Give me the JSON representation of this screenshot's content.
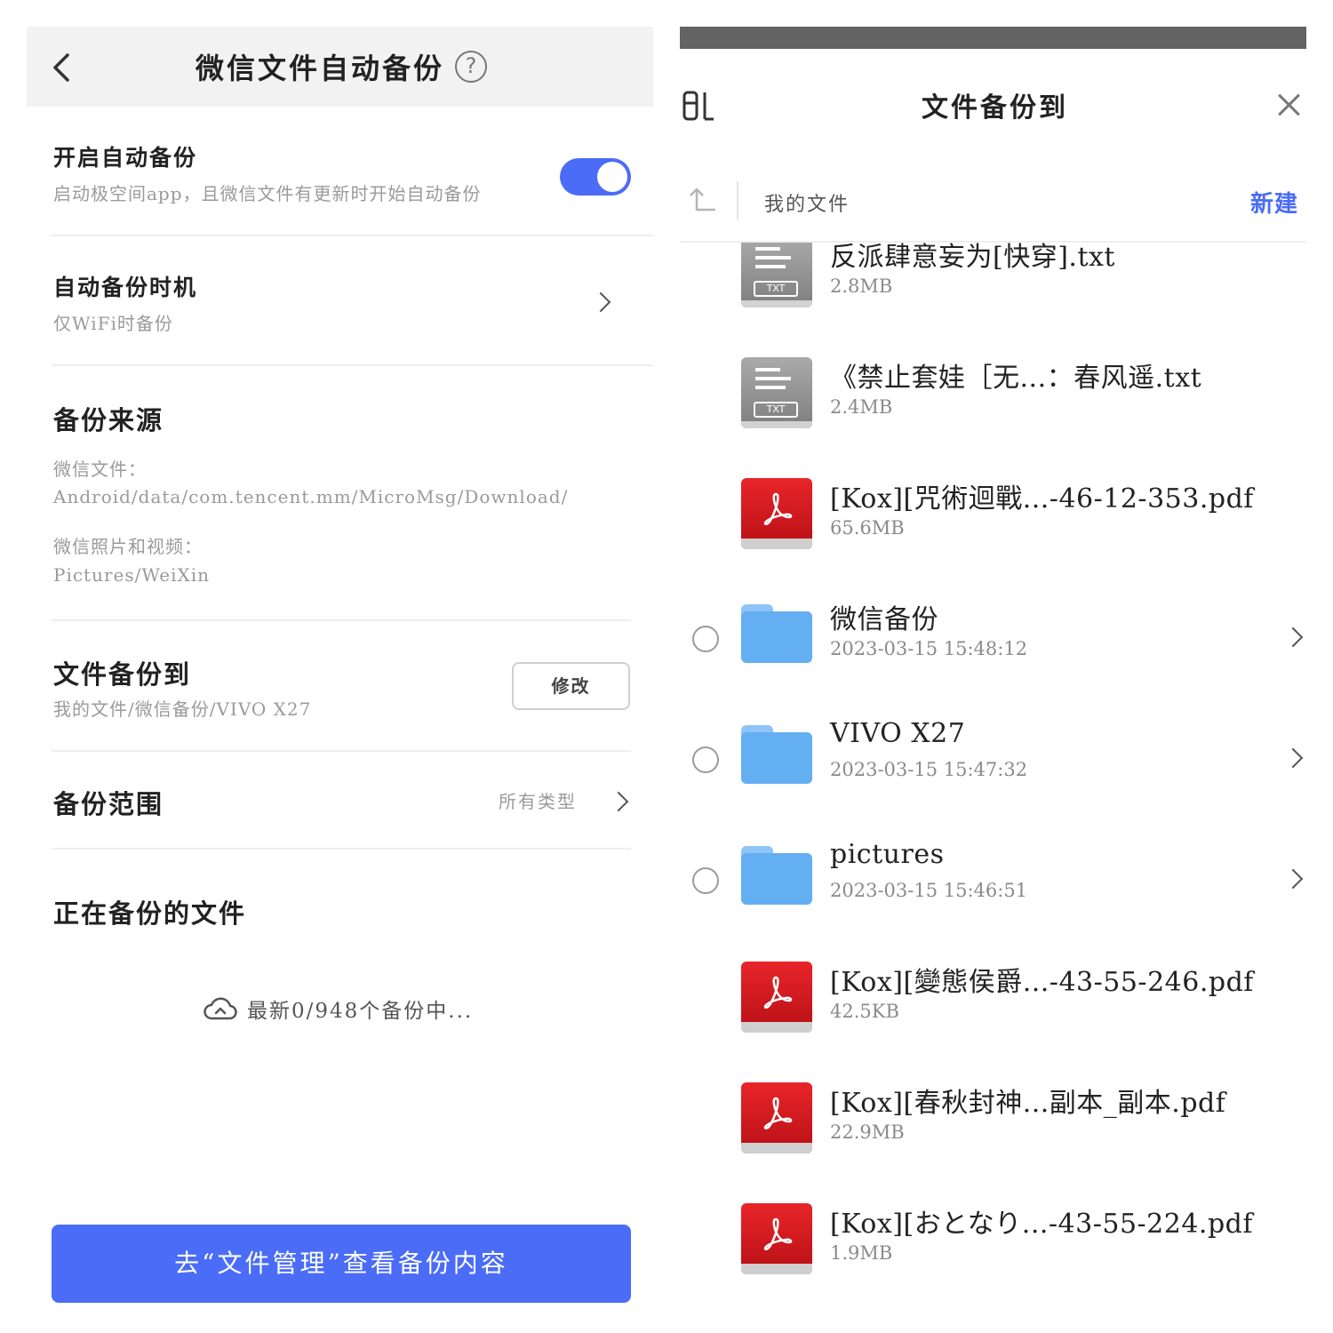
{
  "left": {
    "page_title": "微信文件自动备份",
    "auto_backup": {
      "title": "开启自动备份",
      "desc": "启动极空间app，且微信文件有更新时开始自动备份",
      "enabled": true
    },
    "timing": {
      "title": "自动备份时机",
      "value": "仅WiFi时备份"
    },
    "source": {
      "title": "备份来源",
      "wechat_files_label": "微信文件：",
      "wechat_files_path": "Android/data/com.tencent.mm/MicroMsg/Download/",
      "wechat_media_label": "微信照片和视频：",
      "wechat_media_path": "Pictures/WeiXin"
    },
    "destination": {
      "title": "文件备份到",
      "path": "我的文件/微信备份/VIVO X27",
      "modify_label": "修改"
    },
    "range": {
      "title": "备份范围",
      "value": "所有类型"
    },
    "in_progress": {
      "title": "正在备份的文件",
      "status": "最新0/948个备份中..."
    },
    "primary_button": "去“文件管理”查看备份内容"
  },
  "right": {
    "title": "文件备份到",
    "path_label": "我的文件",
    "new_label": "新建",
    "files": [
      {
        "kind": "txt",
        "name": "反派肆意妄为[快穿].txt",
        "meta": "2.8MB",
        "selectable": false
      },
      {
        "kind": "txt",
        "name": "《禁止套娃［无...：春风遥.txt",
        "meta": "2.4MB",
        "selectable": false
      },
      {
        "kind": "pdf",
        "name": "[Kox][咒術迴戰...-46-12-353.pdf",
        "meta": "65.6MB",
        "selectable": false
      },
      {
        "kind": "folder",
        "name": "微信备份",
        "meta": "2023-03-15 15:48:12",
        "selectable": true
      },
      {
        "kind": "folder",
        "name": "VIVO X27",
        "meta": "2023-03-15 15:47:32",
        "selectable": true
      },
      {
        "kind": "folder",
        "name": "pictures",
        "meta": "2023-03-15 15:46:51",
        "selectable": true
      },
      {
        "kind": "pdf",
        "name": "[Kox][變態侯爵...-43-55-246.pdf",
        "meta": "42.5KB",
        "selectable": false
      },
      {
        "kind": "pdf",
        "name": "[Kox][春秋封神...副本_副本.pdf",
        "meta": "22.9MB",
        "selectable": false
      },
      {
        "kind": "pdf",
        "name": "[Kox][おとなり...-43-55-224.pdf",
        "meta": "1.9MB",
        "selectable": false
      }
    ]
  },
  "colors": {
    "accent": "#4a6cf7",
    "header_bg": "#f2f2f2",
    "muted_text": "#9a9a9a",
    "pdf_red": "#d81e24",
    "folder_blue": "#64aef2"
  }
}
